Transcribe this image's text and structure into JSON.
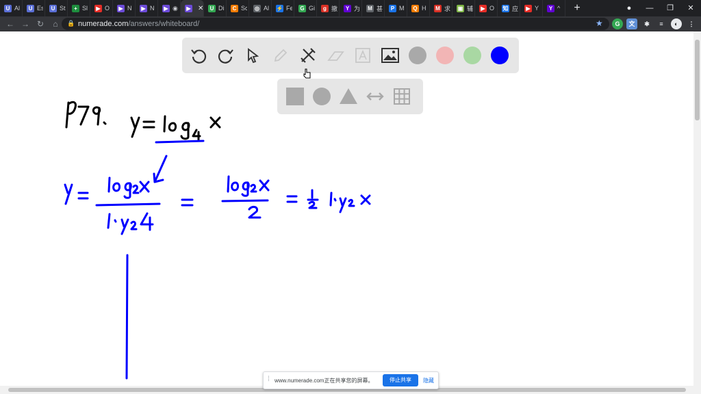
{
  "browser": {
    "tabs": [
      {
        "title": "Al",
        "icon": "udemy-icon",
        "color": "#5b6fd6",
        "glyph": "U"
      },
      {
        "title": "Es",
        "icon": "udemy-icon",
        "color": "#5b6fd6",
        "glyph": "U"
      },
      {
        "title": "St",
        "icon": "udemy-icon",
        "color": "#5b6fd6",
        "glyph": "U"
      },
      {
        "title": "Sl",
        "icon": "sheets-icon",
        "color": "#1e8e3e",
        "glyph": "+"
      },
      {
        "title": "O",
        "icon": "youtube-icon",
        "color": "#e52d27",
        "glyph": "▶"
      },
      {
        "title": "N",
        "icon": "numerade-icon",
        "color": "#6c4bd8",
        "glyph": "▶"
      },
      {
        "title": "N",
        "icon": "numerade-icon",
        "color": "#6c4bd8",
        "glyph": "▶"
      },
      {
        "title": "◉",
        "icon": "numerade-icon",
        "color": "#6c4bd8",
        "glyph": "▶"
      },
      {
        "title": "",
        "icon": "numerade-icon",
        "color": "#6c4bd8",
        "glyph": "▶",
        "active": true
      },
      {
        "title": "Di",
        "icon": "app-icon",
        "color": "#34a853",
        "glyph": "U"
      },
      {
        "title": "Sc",
        "icon": "app-icon",
        "color": "#f57c00",
        "glyph": "C"
      },
      {
        "title": "Al",
        "icon": "globe-icon",
        "color": "#5f6368",
        "glyph": "◎"
      },
      {
        "title": "Fe",
        "icon": "bolt-icon",
        "color": "#1a73e8",
        "glyph": "⚡"
      },
      {
        "title": "Gi",
        "icon": "globe-icon",
        "color": "#34a853",
        "glyph": "G"
      },
      {
        "title": "撤",
        "icon": "app-icon",
        "color": "#d93025",
        "glyph": "g"
      },
      {
        "title": "为",
        "icon": "yahoo-icon",
        "color": "#6001d2",
        "glyph": "Y"
      },
      {
        "title": "甚",
        "icon": "text-icon",
        "color": "#5f6368",
        "glyph": "M"
      },
      {
        "title": "M",
        "icon": "app-icon",
        "color": "#1a73e8",
        "glyph": "P"
      },
      {
        "title": "H",
        "icon": "app-icon",
        "color": "#f57c00",
        "glyph": "Q"
      },
      {
        "title": "求",
        "icon": "gmail-icon",
        "color": "#d93025",
        "glyph": "M"
      },
      {
        "title": "辅",
        "icon": "app-icon",
        "color": "#7cb342",
        "glyph": "▣"
      },
      {
        "title": "O",
        "icon": "youtube-icon",
        "color": "#e52d27",
        "glyph": "▶"
      },
      {
        "title": "应",
        "icon": "app-icon",
        "color": "#1a73e8",
        "glyph": "知"
      },
      {
        "title": "Y",
        "icon": "youtube-icon",
        "color": "#e52d27",
        "glyph": "▶"
      },
      {
        "title": "^",
        "icon": "yahoo-icon",
        "color": "#6001d2",
        "glyph": "Y"
      }
    ],
    "new_tab": "+",
    "url_host": "numerade.com",
    "url_path": "/answers/whiteboard/"
  },
  "toolbar": {
    "colors": {
      "gray": "#a9a9a9",
      "red": "#f2b5b5",
      "green": "#a9d8a3",
      "blue": "#0000ff"
    }
  },
  "share_banner": {
    "message": "www.numerade.com正在共享您的屏幕。",
    "stop_label": "停止共享",
    "hide_label": "隐藏"
  }
}
